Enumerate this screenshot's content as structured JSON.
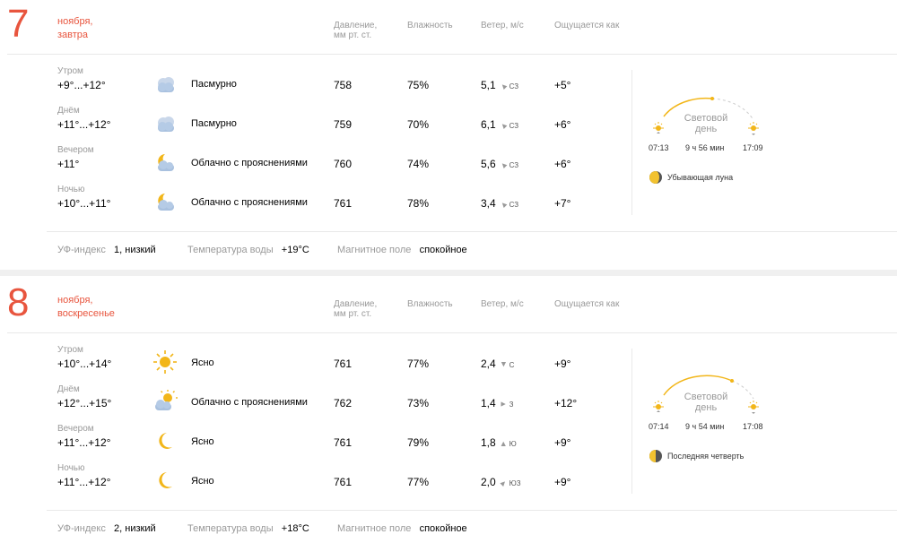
{
  "headers": {
    "pressure_l1": "Давление,",
    "pressure_l2": "мм рт. ст.",
    "humidity": "Влажность",
    "wind": "Ветер, м/с",
    "feels": "Ощущается как"
  },
  "days": [
    {
      "num": "7",
      "month": "ноября,",
      "weekday": "завтра",
      "rows": [
        {
          "part": "Утром",
          "temp": "+9°...+12°",
          "icon": "cloudy-icon",
          "cond": "Пасмурно",
          "pres": "758",
          "hum": "75%",
          "wind": "5,1",
          "dir": "СЗ",
          "feels": "+5°"
        },
        {
          "part": "Днём",
          "temp": "+11°...+12°",
          "icon": "cloudy-icon",
          "cond": "Пасмурно",
          "pres": "759",
          "hum": "70%",
          "wind": "6,1",
          "dir": "СЗ",
          "feels": "+6°"
        },
        {
          "part": "Вечером",
          "temp": "+11°",
          "icon": "night-partly-cloudy-icon",
          "cond": "Облачно с прояснениями",
          "pres": "760",
          "hum": "74%",
          "wind": "5,6",
          "dir": "СЗ",
          "feels": "+6°"
        },
        {
          "part": "Ночью",
          "temp": "+10°...+11°",
          "icon": "night-partly-cloudy-icon",
          "cond": "Облачно с прояснениями",
          "pres": "761",
          "hum": "78%",
          "wind": "3,4",
          "dir": "СЗ",
          "feels": "+7°"
        }
      ],
      "daylight_l1": "Световой",
      "daylight_l2": "день",
      "sunrise": "07:13",
      "duration": "9 ч 56 мин",
      "sunset": "17:09",
      "moon": "Убывающая луна",
      "uv_label": "УФ-индекс",
      "uv_value": "1, низкий",
      "water_label": "Температура воды",
      "water_value": "+19°C",
      "magnetic_label": "Магнитное поле",
      "magnetic_value": "спокойное"
    },
    {
      "num": "8",
      "month": "ноября,",
      "weekday": "воскресенье",
      "rows": [
        {
          "part": "Утром",
          "temp": "+10°...+14°",
          "icon": "sun-icon",
          "cond": "Ясно",
          "pres": "761",
          "hum": "77%",
          "wind": "2,4",
          "dir": "С",
          "feels": "+9°"
        },
        {
          "part": "Днём",
          "temp": "+12°...+15°",
          "icon": "day-partly-cloudy-icon",
          "cond": "Облачно с прояснениями",
          "pres": "762",
          "hum": "73%",
          "wind": "1,4",
          "dir": "З",
          "feels": "+12°"
        },
        {
          "part": "Вечером",
          "temp": "+11°...+12°",
          "icon": "moon-icon",
          "cond": "Ясно",
          "pres": "761",
          "hum": "79%",
          "wind": "1,8",
          "dir": "Ю",
          "feels": "+9°"
        },
        {
          "part": "Ночью",
          "temp": "+11°...+12°",
          "icon": "moon-icon",
          "cond": "Ясно",
          "pres": "761",
          "hum": "77%",
          "wind": "2,0",
          "dir": "ЮЗ",
          "feels": "+9°"
        }
      ],
      "daylight_l1": "Световой",
      "daylight_l2": "день",
      "sunrise": "07:14",
      "duration": "9 ч 54 мин",
      "sunset": "17:08",
      "moon": "Последняя четверть",
      "uv_label": "УФ-индекс",
      "uv_value": "2, низкий",
      "water_label": "Температура воды",
      "water_value": "+18°C",
      "magnetic_label": "Магнитное поле",
      "magnetic_value": "спокойное"
    }
  ]
}
